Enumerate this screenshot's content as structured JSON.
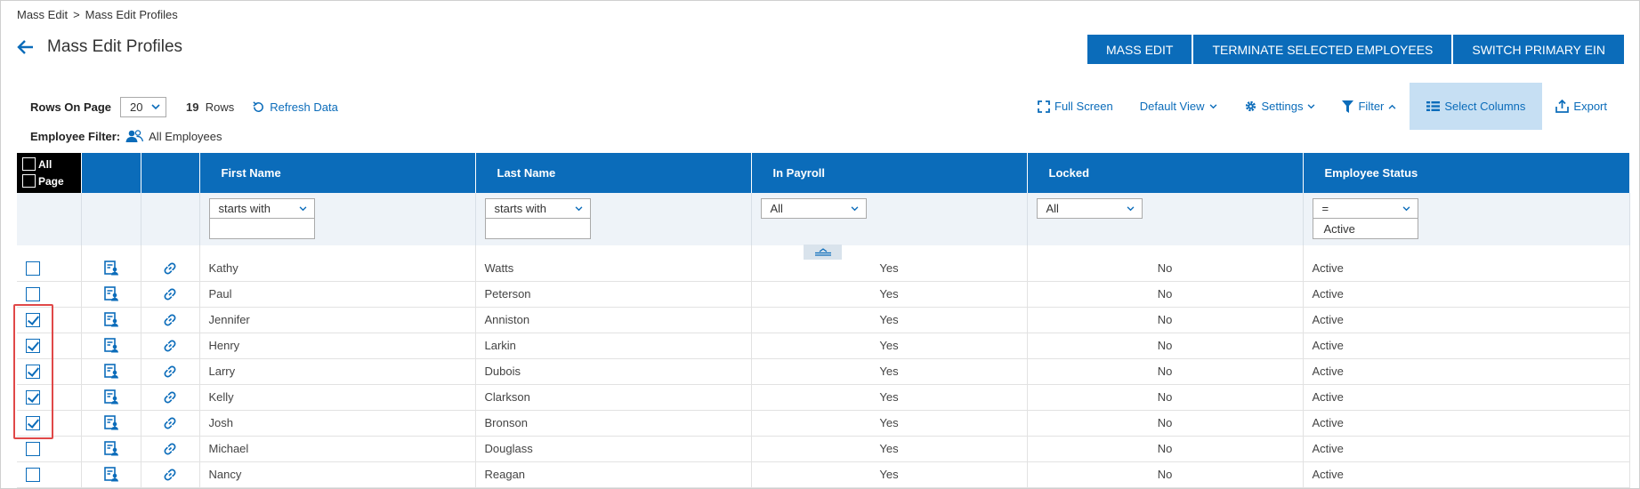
{
  "breadcrumb": {
    "root": "Mass Edit",
    "separator": ">",
    "current": "Mass Edit Profiles"
  },
  "page": {
    "title": "Mass Edit Profiles"
  },
  "top_buttons": {
    "mass_edit": "MASS EDIT",
    "terminate": "TERMINATE SELECTED EMPLOYEES",
    "switch_ein": "SWITCH PRIMARY EIN"
  },
  "toolbar": {
    "rows_on_page_label": "Rows On Page",
    "rows_on_page_value": "20",
    "rows_count": "19",
    "rows_label": "Rows",
    "refresh_label": "Refresh Data",
    "full_screen": "Full Screen",
    "default_view": "Default View",
    "settings": "Settings",
    "filter": "Filter",
    "select_columns": "Select Columns",
    "export": "Export"
  },
  "employee_filter": {
    "label": "Employee Filter:",
    "value": "All Employees"
  },
  "table": {
    "select_all": "All",
    "select_page": "Page",
    "columns": {
      "first_name": "First Name",
      "last_name": "Last Name",
      "in_payroll": "In Payroll",
      "locked": "Locked",
      "employee_status": "Employee Status"
    },
    "filters": {
      "first_name_op": "starts with",
      "first_name_val": "",
      "last_name_op": "starts with",
      "last_name_val": "",
      "in_payroll": "All",
      "locked": "All",
      "status_op": "=",
      "status_val": "Active"
    },
    "rows": [
      {
        "checked": false,
        "first": "Kathy",
        "last": "Watts",
        "payroll": "Yes",
        "locked": "No",
        "status": "Active"
      },
      {
        "checked": false,
        "first": "Paul",
        "last": "Peterson",
        "payroll": "Yes",
        "locked": "No",
        "status": "Active"
      },
      {
        "checked": true,
        "first": "Jennifer",
        "last": "Anniston",
        "payroll": "Yes",
        "locked": "No",
        "status": "Active"
      },
      {
        "checked": true,
        "first": "Henry",
        "last": "Larkin",
        "payroll": "Yes",
        "locked": "No",
        "status": "Active"
      },
      {
        "checked": true,
        "first": "Larry",
        "last": "Dubois",
        "payroll": "Yes",
        "locked": "No",
        "status": "Active"
      },
      {
        "checked": true,
        "first": "Kelly",
        "last": "Clarkson",
        "payroll": "Yes",
        "locked": "No",
        "status": "Active"
      },
      {
        "checked": true,
        "first": "Josh",
        "last": "Bronson",
        "payroll": "Yes",
        "locked": "No",
        "status": "Active"
      },
      {
        "checked": false,
        "first": "Michael",
        "last": "Douglass",
        "payroll": "Yes",
        "locked": "No",
        "status": "Active"
      },
      {
        "checked": false,
        "first": "Nancy",
        "last": "Reagan",
        "payroll": "Yes",
        "locked": "No",
        "status": "Active"
      }
    ]
  },
  "colors": {
    "accent": "#0b6cba",
    "highlight": "#e04848",
    "active_tool_bg": "#c6dff3"
  }
}
